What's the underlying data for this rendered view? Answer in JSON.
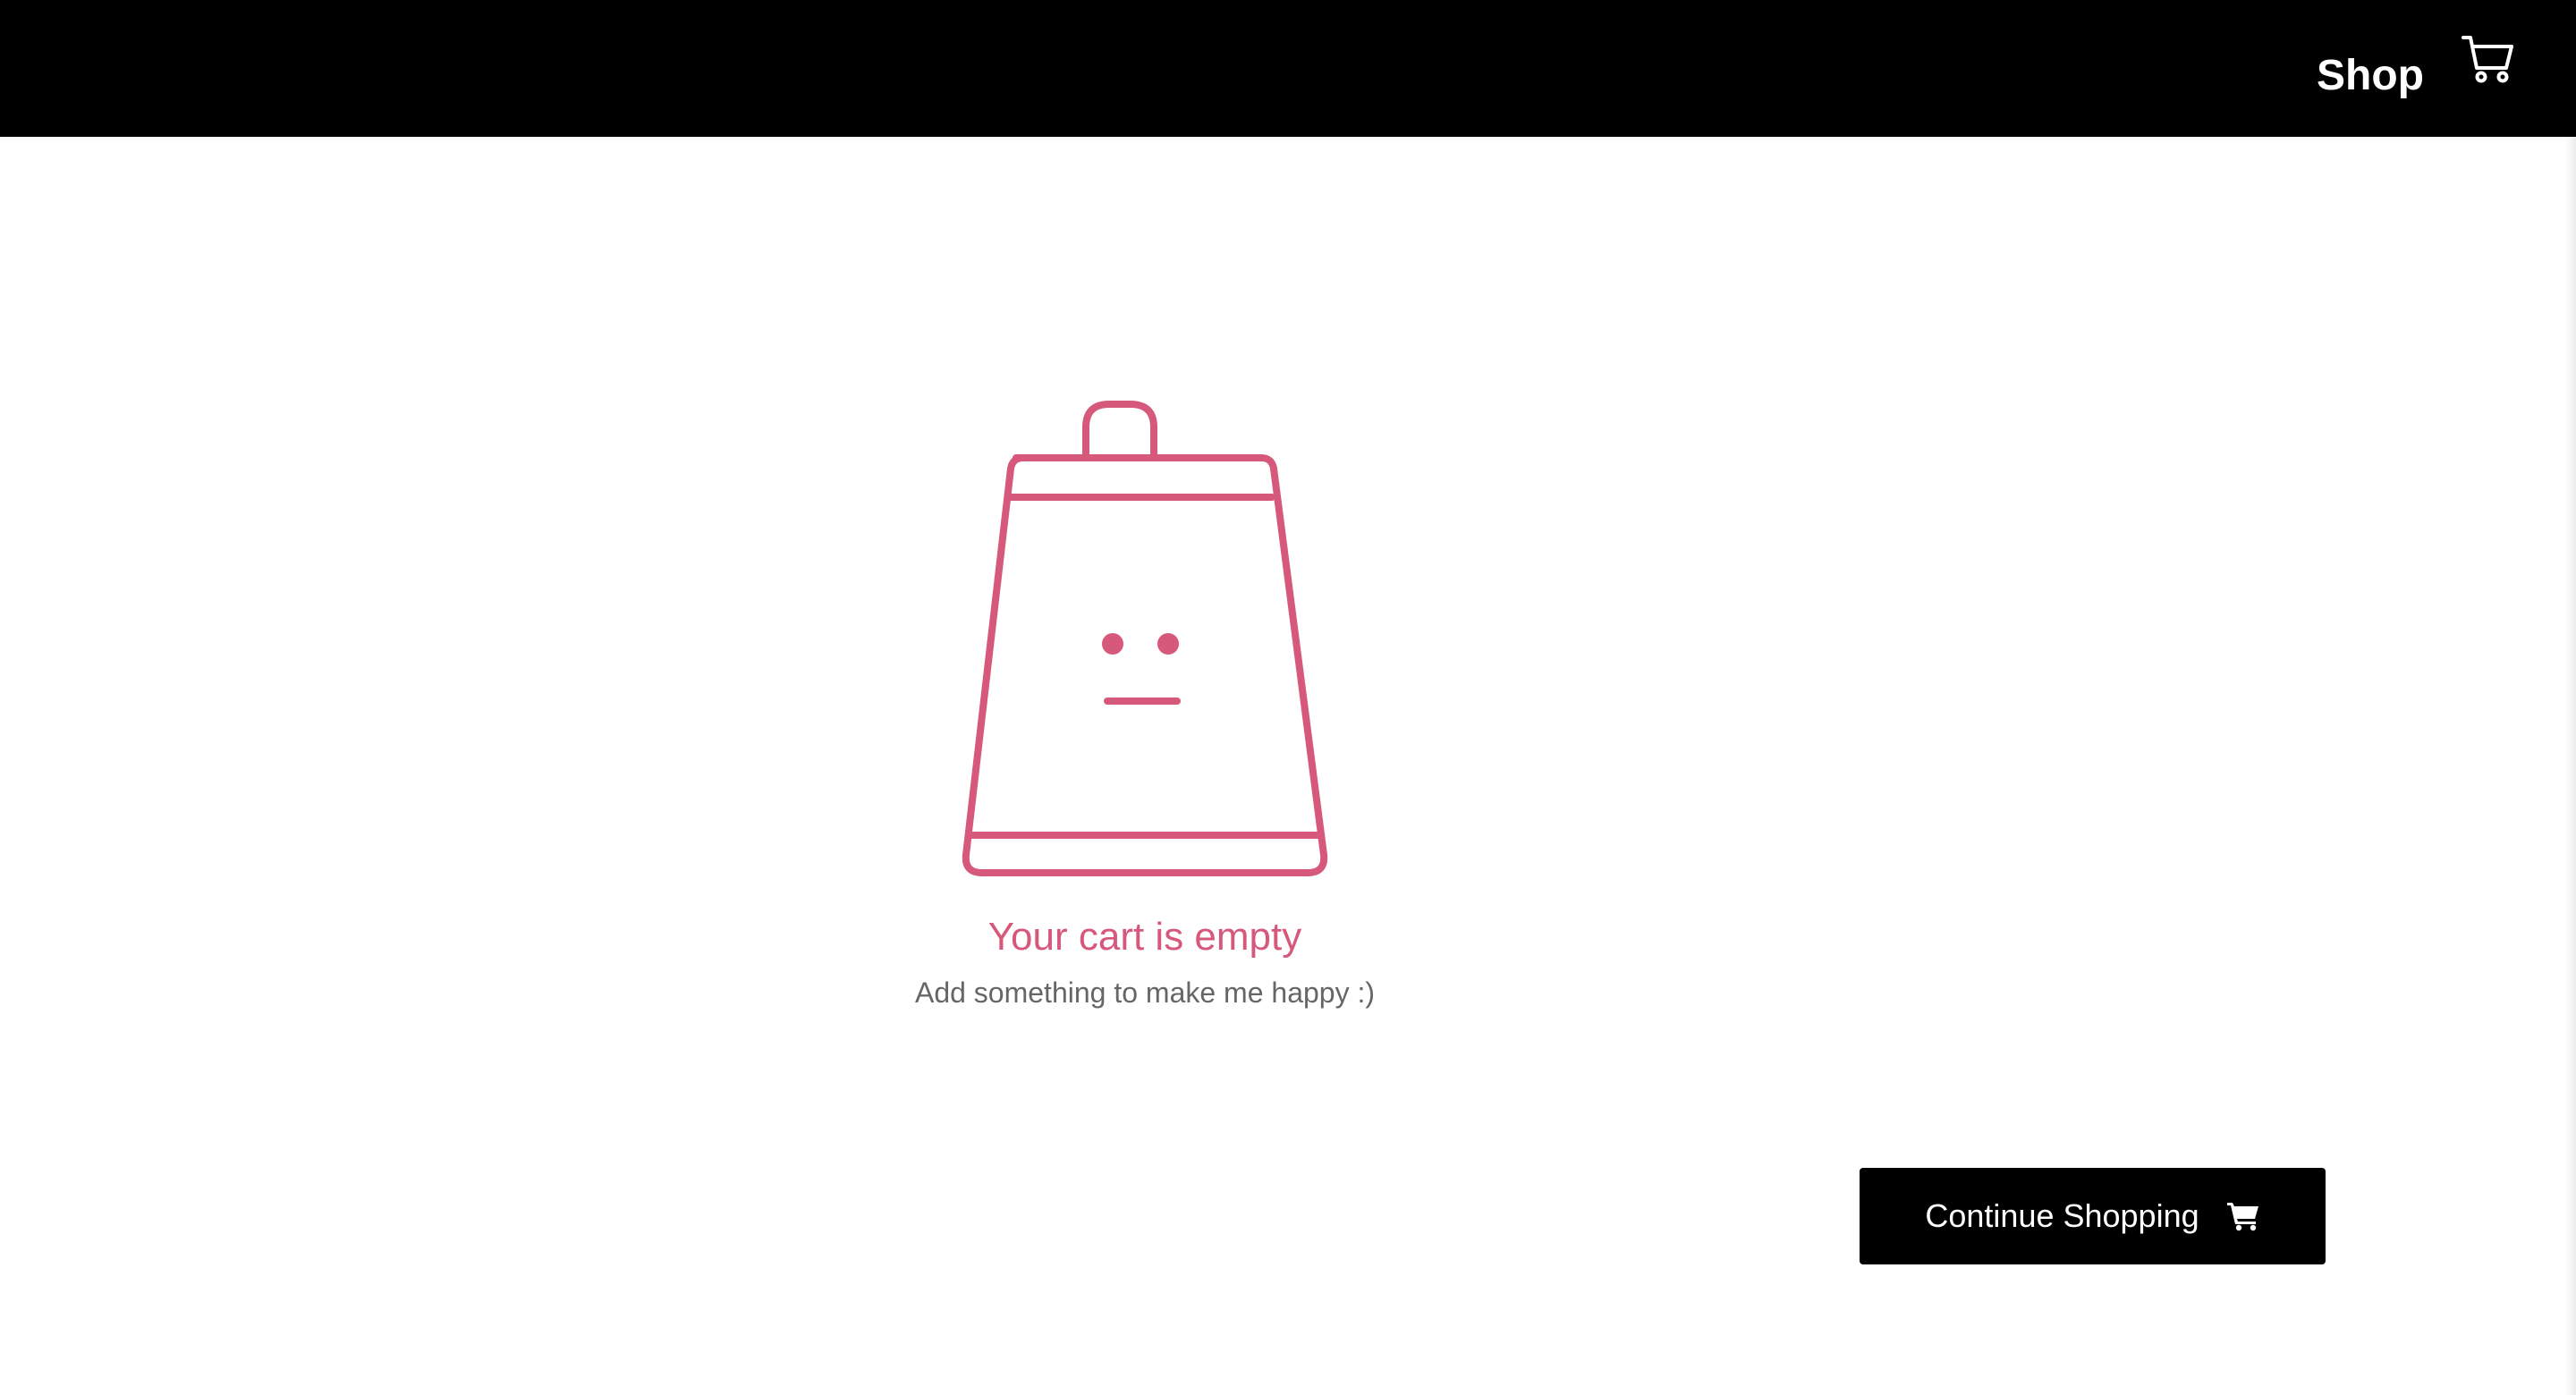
{
  "header": {
    "shop_label": "Shop",
    "cart_icon": "cart-icon"
  },
  "empty_state": {
    "illustration": "empty-shopping-bag-face-icon",
    "title": "Your cart is empty",
    "subtitle": "Add something to make me happy :)"
  },
  "actions": {
    "continue_label": "Continue Shopping",
    "continue_icon": "cart-solid-icon"
  },
  "colors": {
    "navbar_bg": "#000000",
    "accent_pink": "#d6587a",
    "subtitle_gray": "#666666",
    "button_bg": "#000000"
  }
}
